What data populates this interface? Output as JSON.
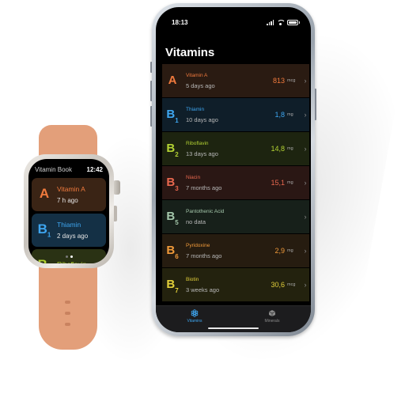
{
  "phone": {
    "status_time": "18:13",
    "title": "Vitamins",
    "items": [
      {
        "letter": "A",
        "sub": "",
        "name": "Vitamin A",
        "when": "5 days ago",
        "value": "813",
        "unit": "mcg",
        "color": "#f07a3d",
        "bg": "#2a1b12"
      },
      {
        "letter": "B",
        "sub": "1",
        "name": "Thiamin",
        "when": "10 days ago",
        "value": "1,8",
        "unit": "mg",
        "color": "#3ea6f0",
        "bg": "#0f1e29"
      },
      {
        "letter": "B",
        "sub": "2",
        "name": "Riboflavin",
        "when": "13 days ago",
        "value": "14,8",
        "unit": "mg",
        "color": "#b3d233",
        "bg": "#1d2410"
      },
      {
        "letter": "B",
        "sub": "3",
        "name": "Niacin",
        "when": "7 months ago",
        "value": "15,1",
        "unit": "mg",
        "color": "#e8684f",
        "bg": "#2a1714"
      },
      {
        "letter": "B",
        "sub": "5",
        "name": "Pantothenic Acid",
        "when": "no data",
        "value": "",
        "unit": "",
        "color": "#a4c7ab",
        "bg": "#17201a"
      },
      {
        "letter": "B",
        "sub": "6",
        "name": "Pyridoxine",
        "when": "7 months ago",
        "value": "2,9",
        "unit": "mg",
        "color": "#f09a3a",
        "bg": "#261c10"
      },
      {
        "letter": "B",
        "sub": "7",
        "name": "Biotin",
        "when": "3 weeks ago",
        "value": "30,6",
        "unit": "mcg",
        "color": "#e2cf3a",
        "bg": "#23220e"
      }
    ],
    "tabs": [
      {
        "label": "Vitamins",
        "icon": "vitamins-icon",
        "color": "#3ea6f0"
      },
      {
        "label": "Minerals",
        "icon": "minerals-icon",
        "color": "#8a8a8a"
      }
    ]
  },
  "watch": {
    "title": "Vitamin Book",
    "time": "12:42",
    "items": [
      {
        "letter": "A",
        "sub": "",
        "name": "Vitamin A",
        "when": "7 h ago",
        "color": "#f07a3d",
        "bg": "#3a2415"
      },
      {
        "letter": "B",
        "sub": "1",
        "name": "Thiamin",
        "when": "2 days ago",
        "color": "#3ea6f0",
        "bg": "#143045"
      },
      {
        "letter": "B",
        "sub": "2",
        "name": "Riboflavin",
        "when": "",
        "color": "#b3d233",
        "bg": "#2a3214"
      }
    ],
    "page_dots": 2,
    "active_dot": 1
  }
}
